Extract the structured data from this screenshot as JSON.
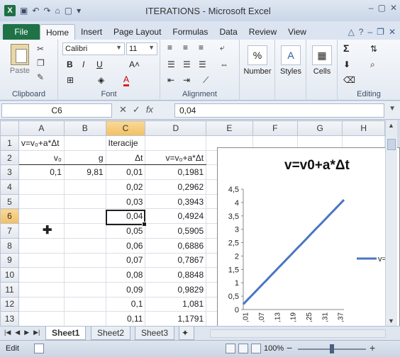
{
  "window": {
    "app_icon": "X",
    "title": "ITERATIONS - Microsoft Excel",
    "qat_icons": [
      "save-icon",
      "undo-icon",
      "redo-icon",
      "open-icon",
      "new-icon",
      "customize-icon"
    ]
  },
  "ribbon_tabs": [
    "File",
    "Home",
    "Insert",
    "Page Layout",
    "Formulas",
    "Data",
    "Review",
    "View"
  ],
  "ribbon": {
    "clipboard": {
      "label": "Clipboard",
      "paste": "Paste"
    },
    "font": {
      "label": "Font",
      "name": "Calibri",
      "size": "11",
      "bold": "B",
      "italic": "I",
      "underline": "U",
      "font_color_glyph": "A"
    },
    "alignment": {
      "label": "Alignment"
    },
    "number": {
      "label": "Number",
      "glyph": "%"
    },
    "styles": {
      "label": "Styles",
      "glyph": "A"
    },
    "cells": {
      "label": "Cells"
    },
    "editing": {
      "label": "Editing",
      "sum_glyph": "Σ"
    }
  },
  "formula_bar": {
    "name_box": "C6",
    "fx": "fx",
    "value": "0,04"
  },
  "grid": {
    "columns": [
      "A",
      "B",
      "C",
      "D",
      "E",
      "F",
      "G",
      "H"
    ],
    "selected_column": "C",
    "selected_row": "6",
    "rows": [
      {
        "num": "1",
        "A": "v=v₀+a*Δt",
        "B": "",
        "C": "Iteracije",
        "D": ""
      },
      {
        "num": "2",
        "A": "v₀",
        "B": "g",
        "C": "Δt",
        "D": "v=v₀+a*Δt"
      },
      {
        "num": "3",
        "A": "0,1",
        "B": "9,81",
        "C": "0,01",
        "D": "0,1981"
      },
      {
        "num": "4",
        "A": "",
        "B": "",
        "C": "0,02",
        "D": "0,2962"
      },
      {
        "num": "5",
        "A": "",
        "B": "",
        "C": "0,03",
        "D": "0,3943"
      },
      {
        "num": "6",
        "A": "",
        "B": "",
        "C": "0,04",
        "D": "0,4924"
      },
      {
        "num": "7",
        "A": "",
        "B": "",
        "C": "0,05",
        "D": "0,5905"
      },
      {
        "num": "8",
        "A": "",
        "B": "",
        "C": "0,06",
        "D": "0,6886"
      },
      {
        "num": "9",
        "A": "",
        "B": "",
        "C": "0,07",
        "D": "0,7867"
      },
      {
        "num": "10",
        "A": "",
        "B": "",
        "C": "0,08",
        "D": "0,8848"
      },
      {
        "num": "11",
        "A": "",
        "B": "",
        "C": "0,09",
        "D": "0,9829"
      },
      {
        "num": "12",
        "A": "",
        "B": "",
        "C": "0,1",
        "D": "1,081"
      },
      {
        "num": "13",
        "A": "",
        "B": "",
        "C": "0,11",
        "D": "1,1791"
      }
    ]
  },
  "chart_data": {
    "type": "line",
    "title": "v=v0+a*Δt",
    "ylim": [
      0,
      4.5
    ],
    "y_ticks": [
      "0",
      "0,5",
      "1",
      "1,5",
      "2",
      "2,5",
      "3",
      "3,5",
      "4",
      "4,5"
    ],
    "x_tick_labels": [
      ",01",
      ",07",
      ",13",
      ",19",
      ",25",
      ",31",
      ",37"
    ],
    "legend_label": "v=",
    "series": [
      {
        "name": "v=",
        "color": "#4a76c2",
        "start": 0.1981,
        "end": 4.1,
        "points": 41
      }
    ]
  },
  "sheet_tabs": [
    "Sheet1",
    "Sheet2",
    "Sheet3"
  ],
  "status": {
    "mode": "Edit",
    "zoom": "100%",
    "zoom_fraction": 0.5
  }
}
